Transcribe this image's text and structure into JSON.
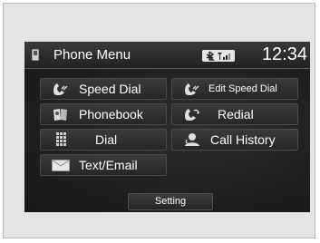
{
  "header": {
    "title": "Phone Menu",
    "time": "12:34",
    "phone_icon": "phone-icon",
    "status_icons": [
      "bluetooth-icon",
      "signal-strength-icon"
    ]
  },
  "menu": {
    "speed_dial": {
      "label": "Speed Dial",
      "icon": "speed-dial-icon"
    },
    "edit_speed_dial": {
      "label": "Edit Speed Dial",
      "icon": "edit-speed-dial-icon"
    },
    "phonebook": {
      "label": "Phonebook",
      "icon": "phonebook-icon"
    },
    "redial": {
      "label": "Redial",
      "icon": "redial-icon"
    },
    "dial": {
      "label": "Dial",
      "icon": "keypad-icon"
    },
    "call_history": {
      "label": "Call History",
      "icon": "call-history-icon"
    },
    "text_email": {
      "label": "Text/Email",
      "icon": "envelope-icon"
    }
  },
  "footer": {
    "setting_label": "Setting"
  },
  "colors": {
    "screen_background": "#1c1c1c",
    "button_background": "#333333",
    "text": "#ffffff",
    "page_frame": "#e4e4e4"
  }
}
